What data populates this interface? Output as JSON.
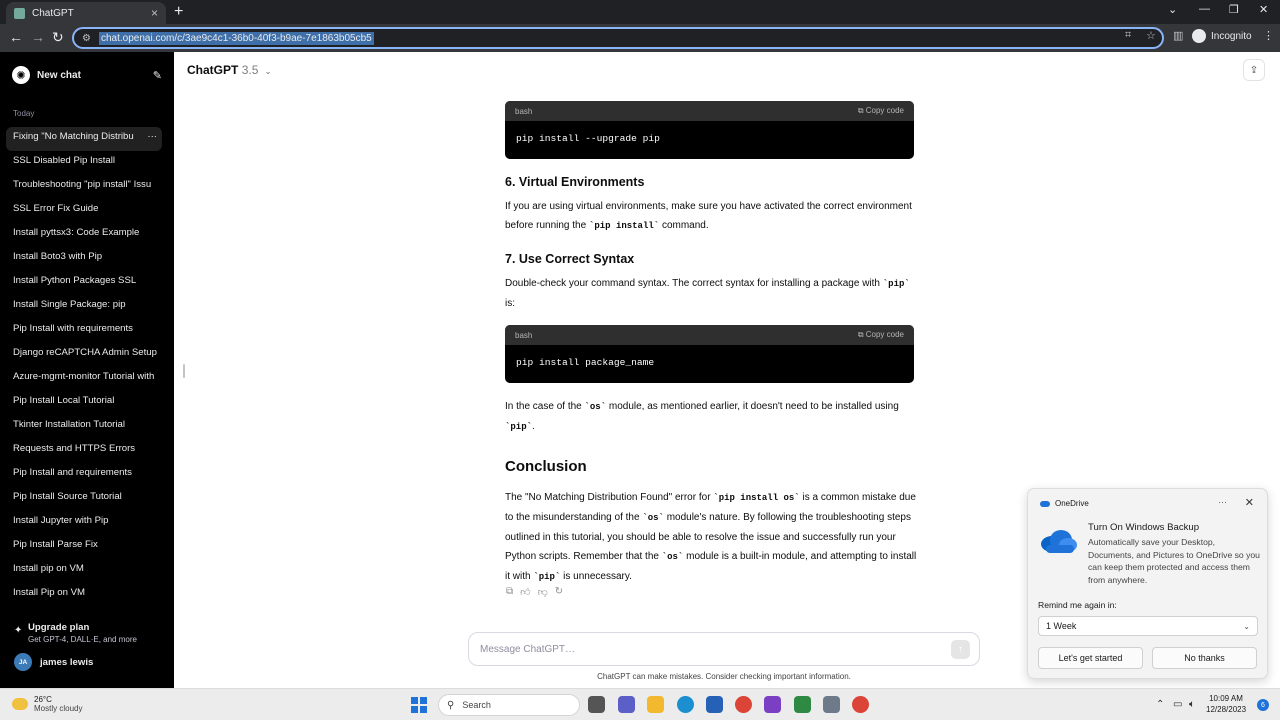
{
  "browser": {
    "tab_title": "ChatGPT",
    "url": "chat.openai.com/c/3ae9c4c1-36b0-40f3-b9ae-7e1863b05cb5",
    "profile_label": "Incognito"
  },
  "sidebar": {
    "new_chat": "New chat",
    "section_label": "Today",
    "items": [
      {
        "label": "Fixing \"No Matching Distribu"
      },
      {
        "label": "SSL Disabled Pip Install"
      },
      {
        "label": "Troubleshooting \"pip install\" Issu"
      },
      {
        "label": "SSL Error Fix Guide"
      },
      {
        "label": "Install pyttsx3: Code Example"
      },
      {
        "label": "Install Boto3 with Pip"
      },
      {
        "label": "Install Python Packages SSL"
      },
      {
        "label": "Install Single Package: pip"
      },
      {
        "label": "Pip Install with requirements"
      },
      {
        "label": "Django reCAPTCHA Admin Setup"
      },
      {
        "label": "Azure-mgmt-monitor Tutorial with"
      },
      {
        "label": "Pip Install Local Tutorial"
      },
      {
        "label": "Tkinter Installation Tutorial"
      },
      {
        "label": "Requests and HTTPS Errors"
      },
      {
        "label": "Pip Install and requirements"
      },
      {
        "label": "Pip Install Source Tutorial"
      },
      {
        "label": "Install Jupyter with Pip"
      },
      {
        "label": "Pip Install Parse Fix"
      },
      {
        "label": "Install pip on VM"
      },
      {
        "label": "Install Pip on VM"
      }
    ],
    "upgrade_title": "Upgrade plan",
    "upgrade_sub": "Get GPT-4, DALL·E, and more",
    "user_initials": "JA",
    "user_name": "james lewis"
  },
  "header": {
    "model_name": "ChatGPT",
    "model_version": "3.5"
  },
  "content": {
    "code1_lang": "bash",
    "code1_copy": "Copy code",
    "code1_text": "pip install --upgrade pip",
    "h6": "6. Virtual Environments",
    "p6_a": "If you are using virtual environments, make sure you have activated the correct environment before running the ",
    "p6_code": "`pip install`",
    "p6_b": " command.",
    "h7": "7. Use Correct Syntax",
    "p7_a": "Double-check your command syntax. The correct syntax for installing a package with ",
    "p7_code": "`pip`",
    "p7_b": " is:",
    "code2_lang": "bash",
    "code2_copy": "Copy code",
    "code2_text": "pip install package_name",
    "p8_a": "In the case of the ",
    "p8_code1": "`os`",
    "p8_b": " module, as mentioned earlier, it doesn't need to be installed using ",
    "p8_code2": "`pip`",
    "p8_c": ".",
    "conclusion_title": "Conclusion",
    "c_a": "The \"No Matching Distribution Found\" error for ",
    "c_code1": "`pip install os`",
    "c_b": " is a common mistake due to the misunderstanding of the ",
    "c_code2": "`os`",
    "c_c": " module's nature. By following the troubleshooting steps outlined in this tutorial, you should be able to resolve the issue and successfully run your Python scripts. Remember that the ",
    "c_code3": "`os`",
    "c_d": " module is a built-in module, and attempting to install it with ",
    "c_code4": "`pip`",
    "c_e": " is unnecessary."
  },
  "composer": {
    "placeholder": "Message ChatGPT…",
    "disclaimer": "ChatGPT can make mistakes. Consider checking important information."
  },
  "onedrive": {
    "app_name": "OneDrive",
    "more": "···",
    "title": "Turn On Windows Backup",
    "body": "Automatically save your Desktop, Documents, and Pictures to OneDrive so you can keep them protected and access them from anywhere.",
    "remind_label": "Remind me again in:",
    "remind_value": "1 Week",
    "primary_btn": "Let's get started",
    "secondary_btn": "No thanks"
  },
  "taskbar": {
    "temp": "26°C",
    "condition": "Mostly cloudy",
    "search_label": "Search",
    "time": "10:09 AM",
    "date": "12/28/2023",
    "notifications": "6"
  },
  "colors": {
    "sidebar_bg": "#000000",
    "accent": "#8ab4f8",
    "windows_blue": "#1f73d8"
  }
}
